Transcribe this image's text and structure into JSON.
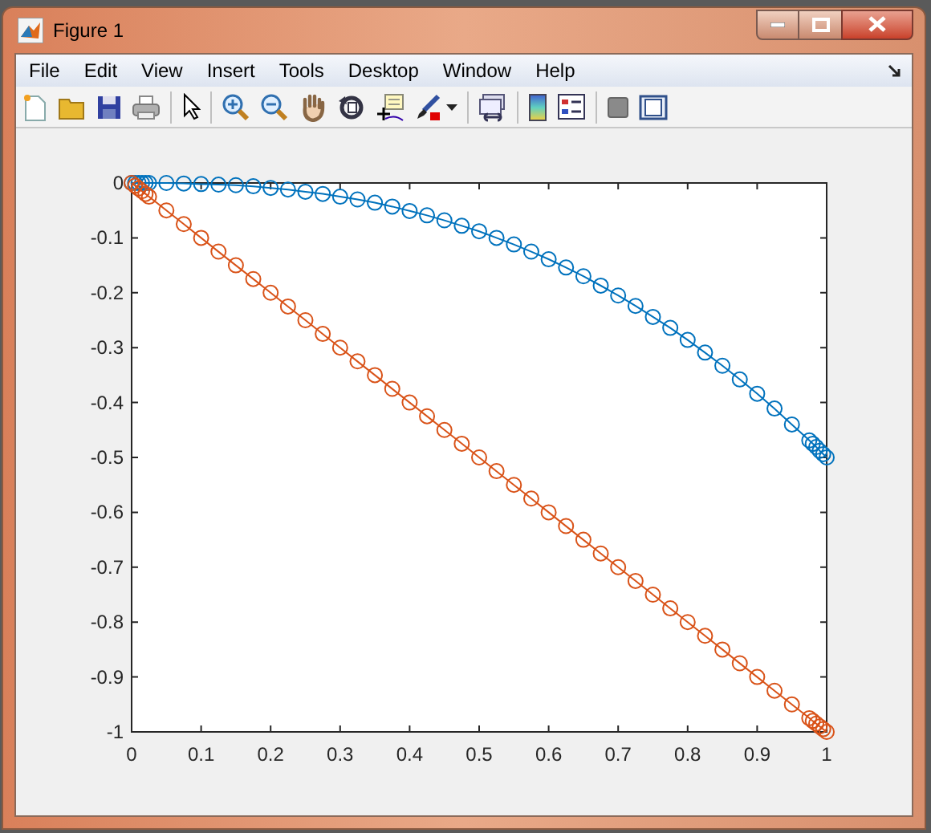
{
  "window": {
    "title": "Figure 1"
  },
  "menu": [
    "File",
    "Edit",
    "View",
    "Insert",
    "Tools",
    "Desktop",
    "Window",
    "Help"
  ],
  "axes": {
    "chart_data": {
      "type": "line",
      "xlim": [
        0,
        1
      ],
      "ylim": [
        -1,
        0
      ],
      "xticks": [
        0,
        0.1,
        0.2,
        0.3,
        0.4,
        0.5,
        0.6,
        0.7,
        0.8,
        0.9,
        1
      ],
      "yticks": [
        {
          "value": 0,
          "label": "0"
        },
        {
          "value": -0.1,
          "label": "-0.1"
        },
        {
          "value": -0.2,
          "label": "-0.2"
        },
        {
          "value": -0.3,
          "label": "-0.3"
        },
        {
          "value": -0.4,
          "label": "-0.4"
        },
        {
          "value": -0.5,
          "label": "-0.5"
        },
        {
          "value": -0.6,
          "label": "-0.6"
        },
        {
          "value": -0.7,
          "label": "-0.7"
        },
        {
          "value": -0.8,
          "label": "-0.8"
        },
        {
          "value": -0.9,
          "label": "-0.9"
        },
        {
          "value": -1,
          "label": "-1"
        }
      ],
      "x": [
        0,
        0.005,
        0.01,
        0.015,
        0.02,
        0.025,
        0.05,
        0.075,
        0.1,
        0.125,
        0.15,
        0.175,
        0.2,
        0.225,
        0.25,
        0.275,
        0.3,
        0.325,
        0.35,
        0.375,
        0.4,
        0.425,
        0.45,
        0.475,
        0.5,
        0.525,
        0.55,
        0.575,
        0.6,
        0.625,
        0.65,
        0.675,
        0.7,
        0.725,
        0.75,
        0.775,
        0.8,
        0.825,
        0.85,
        0.875,
        0.9,
        0.925,
        0.95,
        0.975,
        0.98,
        0.985,
        0.99,
        0.995,
        1
      ],
      "series": [
        {
          "color": "#0072bd",
          "marker": "o",
          "values": [
            0,
            0,
            0,
            0,
            0,
            0,
            0,
            -0.001,
            -0.002,
            -0.003,
            -0.004,
            -0.006,
            -0.009,
            -0.012,
            -0.016,
            -0.02,
            -0.025,
            -0.03,
            -0.036,
            -0.043,
            -0.051,
            -0.059,
            -0.068,
            -0.078,
            -0.088,
            -0.1,
            -0.112,
            -0.125,
            -0.139,
            -0.154,
            -0.17,
            -0.187,
            -0.205,
            -0.224,
            -0.244,
            -0.264,
            -0.286,
            -0.309,
            -0.333,
            -0.358,
            -0.384,
            -0.411,
            -0.44,
            -0.469,
            -0.475,
            -0.481,
            -0.488,
            -0.494,
            -0.5
          ]
        },
        {
          "color": "#d95319",
          "marker": "o",
          "values": [
            0,
            -0.005,
            -0.01,
            -0.015,
            -0.02,
            -0.025,
            -0.05,
            -0.075,
            -0.1,
            -0.125,
            -0.15,
            -0.175,
            -0.2,
            -0.225,
            -0.25,
            -0.275,
            -0.3,
            -0.325,
            -0.35,
            -0.375,
            -0.4,
            -0.425,
            -0.45,
            -0.475,
            -0.5,
            -0.525,
            -0.55,
            -0.575,
            -0.6,
            -0.625,
            -0.65,
            -0.675,
            -0.7,
            -0.725,
            -0.75,
            -0.775,
            -0.8,
            -0.825,
            -0.85,
            -0.875,
            -0.9,
            -0.925,
            -0.95,
            -0.975,
            -0.98,
            -0.985,
            -0.99,
            -0.995,
            -1
          ]
        }
      ]
    }
  }
}
